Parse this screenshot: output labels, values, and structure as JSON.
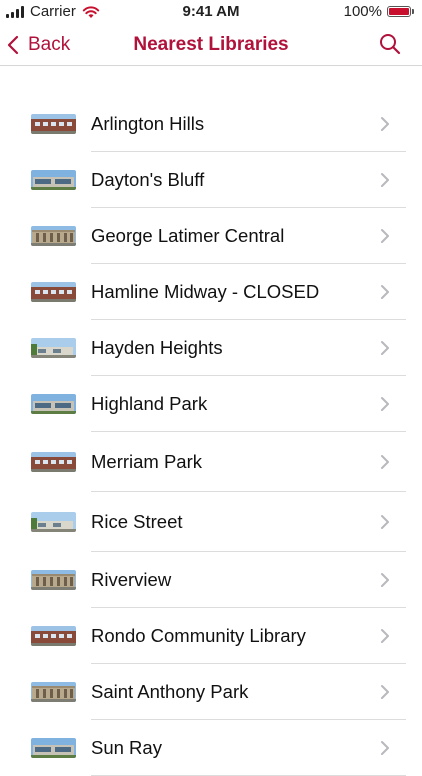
{
  "status_bar": {
    "carrier": "Carrier",
    "time": "9:41 AM",
    "battery": "100%"
  },
  "nav": {
    "back_label": "Back",
    "title": "Nearest Libraries"
  },
  "colors": {
    "accent": "#b0123b",
    "battery_fill": "#c8102e"
  },
  "libraries": [
    {
      "name": "Arlington Hills",
      "thumb": "brick-building"
    },
    {
      "name": "Dayton's Bluff",
      "thumb": "modern-building"
    },
    {
      "name": "George Latimer Central",
      "thumb": "classical-building"
    },
    {
      "name": "Hamline Midway - CLOSED",
      "thumb": "brick-building"
    },
    {
      "name": "Hayden Heights",
      "thumb": "low-building"
    },
    {
      "name": "Highland Park",
      "thumb": "modern-building"
    },
    {
      "name": "Merriam Park",
      "thumb": "brick-building"
    },
    {
      "name": "Rice Street",
      "thumb": "low-building"
    },
    {
      "name": "Riverview",
      "thumb": "classical-building"
    },
    {
      "name": "Rondo Community Library",
      "thumb": "brick-building"
    },
    {
      "name": "Saint Anthony Park",
      "thumb": "classical-building"
    },
    {
      "name": "Sun Ray",
      "thumb": "modern-building"
    }
  ]
}
